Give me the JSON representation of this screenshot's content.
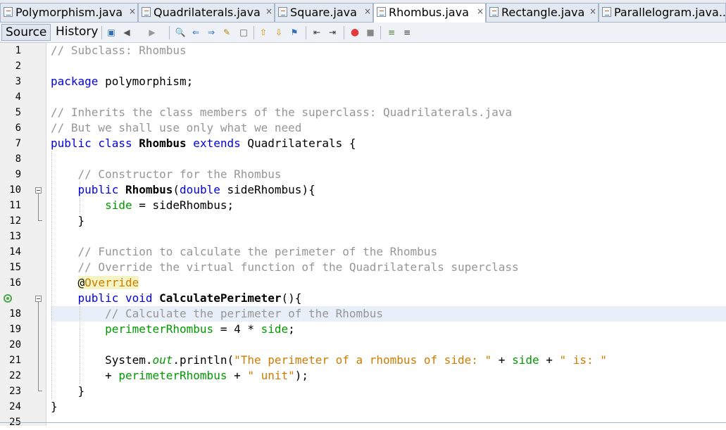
{
  "tabs": [
    {
      "label": "Polymorphism.java",
      "close": "×"
    },
    {
      "label": "Quadrilaterals.java",
      "close": "×"
    },
    {
      "label": "Square.java",
      "close": "×"
    },
    {
      "label": "Rhombus.java",
      "close": "×"
    },
    {
      "label": "Rectangle.java",
      "close": "×"
    },
    {
      "label": "Parallelogram.java..."
    }
  ],
  "toolbar": {
    "source_label": "Source",
    "history_label": "History"
  },
  "editor": {
    "line_numbers": [
      "1",
      "2",
      "3",
      "4",
      "5",
      "6",
      "7",
      "8",
      "9",
      "10",
      "11",
      "12",
      "13",
      "14",
      "15",
      "16",
      "",
      "18",
      "19",
      "20",
      "21",
      "22",
      "23",
      "24",
      "25"
    ],
    "code": {
      "l1": "// Subclass: Rhombus",
      "l3_kw": "package",
      "l3_rest": " polymorphism;",
      "l5": "// Inherits the class members of the superclass: Quadrilaterals.java",
      "l6": "// But we shall use only what we need",
      "l7_kw1": "public class ",
      "l7_name": "Rhombus",
      "l7_kw2": " extends ",
      "l7_rest": "Quadrilaterals {",
      "l9": "// Constructor for the Rhombus",
      "l10_kw": "public ",
      "l10_name": "Rhombus",
      "l10_p1": "(",
      "l10_kw2": "double",
      "l10_p2": " sideRhombus){",
      "l11_field": "side",
      "l11_rest": " = sideRhombus;",
      "l12": "}",
      "l14": "// Function to calculate the perimeter of the Rhombus",
      "l15": "// Override the virtual function of the Quadrilaterals superclass",
      "l16_at": "@",
      "l16_name": "Override",
      "l17_kw": "public void ",
      "l17_name": "CalculatePerimeter",
      "l17_rest": "(){",
      "l18": "// Calculate the perimeter of the Rhombus",
      "l19_field": "perimeterRhombus",
      "l19_mid": " = 4 * ",
      "l19_field2": "side",
      "l19_end": ";",
      "l21_a": "System.",
      "l21_out": "out",
      "l21_b": ".println(",
      "l21_str1": "\"The perimeter of a rhombus of side: \"",
      "l21_c": " + ",
      "l21_field": "side",
      "l21_d": " + ",
      "l21_str2": "\" is: \"",
      "l22_a": "+ ",
      "l22_field": "perimeterRhombus",
      "l22_b": " + ",
      "l22_str": "\" unit\"",
      "l22_c": ");",
      "l23": "}",
      "l24": "}"
    }
  },
  "colors": {
    "keyword": "#0000e6",
    "comment": "#969696",
    "string": "#ce7b00",
    "field": "#009900",
    "current_line": "#e9eff8"
  }
}
